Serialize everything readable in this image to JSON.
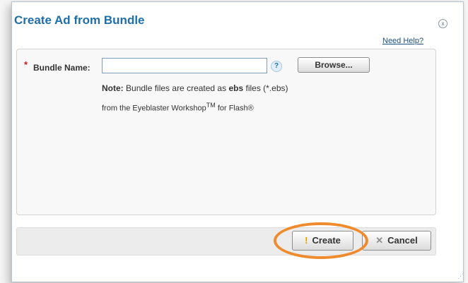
{
  "dialog": {
    "title": "Create Ad from Bundle",
    "close_icon": "x",
    "help_link": "Need Help?"
  },
  "form": {
    "required_mark": "*",
    "bundle_label": "Bundle Name:",
    "bundle_value": "",
    "help_icon": "?",
    "browse_label": "Browse...",
    "note_prefix": "Note:",
    "note_text_1": "Bundle files are created as",
    "note_bold": "ebs",
    "note_text_2": "files (*.ebs)",
    "note_line2": "from the Eyeblaster Workshop",
    "note_tm": "TM",
    "note_line2_end": "for Flash®"
  },
  "footer": {
    "create_icon": "!",
    "create_label": "Create",
    "cancel_icon": "✕",
    "cancel_label": "Cancel"
  },
  "colors": {
    "title": "#1f6ea8",
    "highlight": "#ef8b2c"
  }
}
